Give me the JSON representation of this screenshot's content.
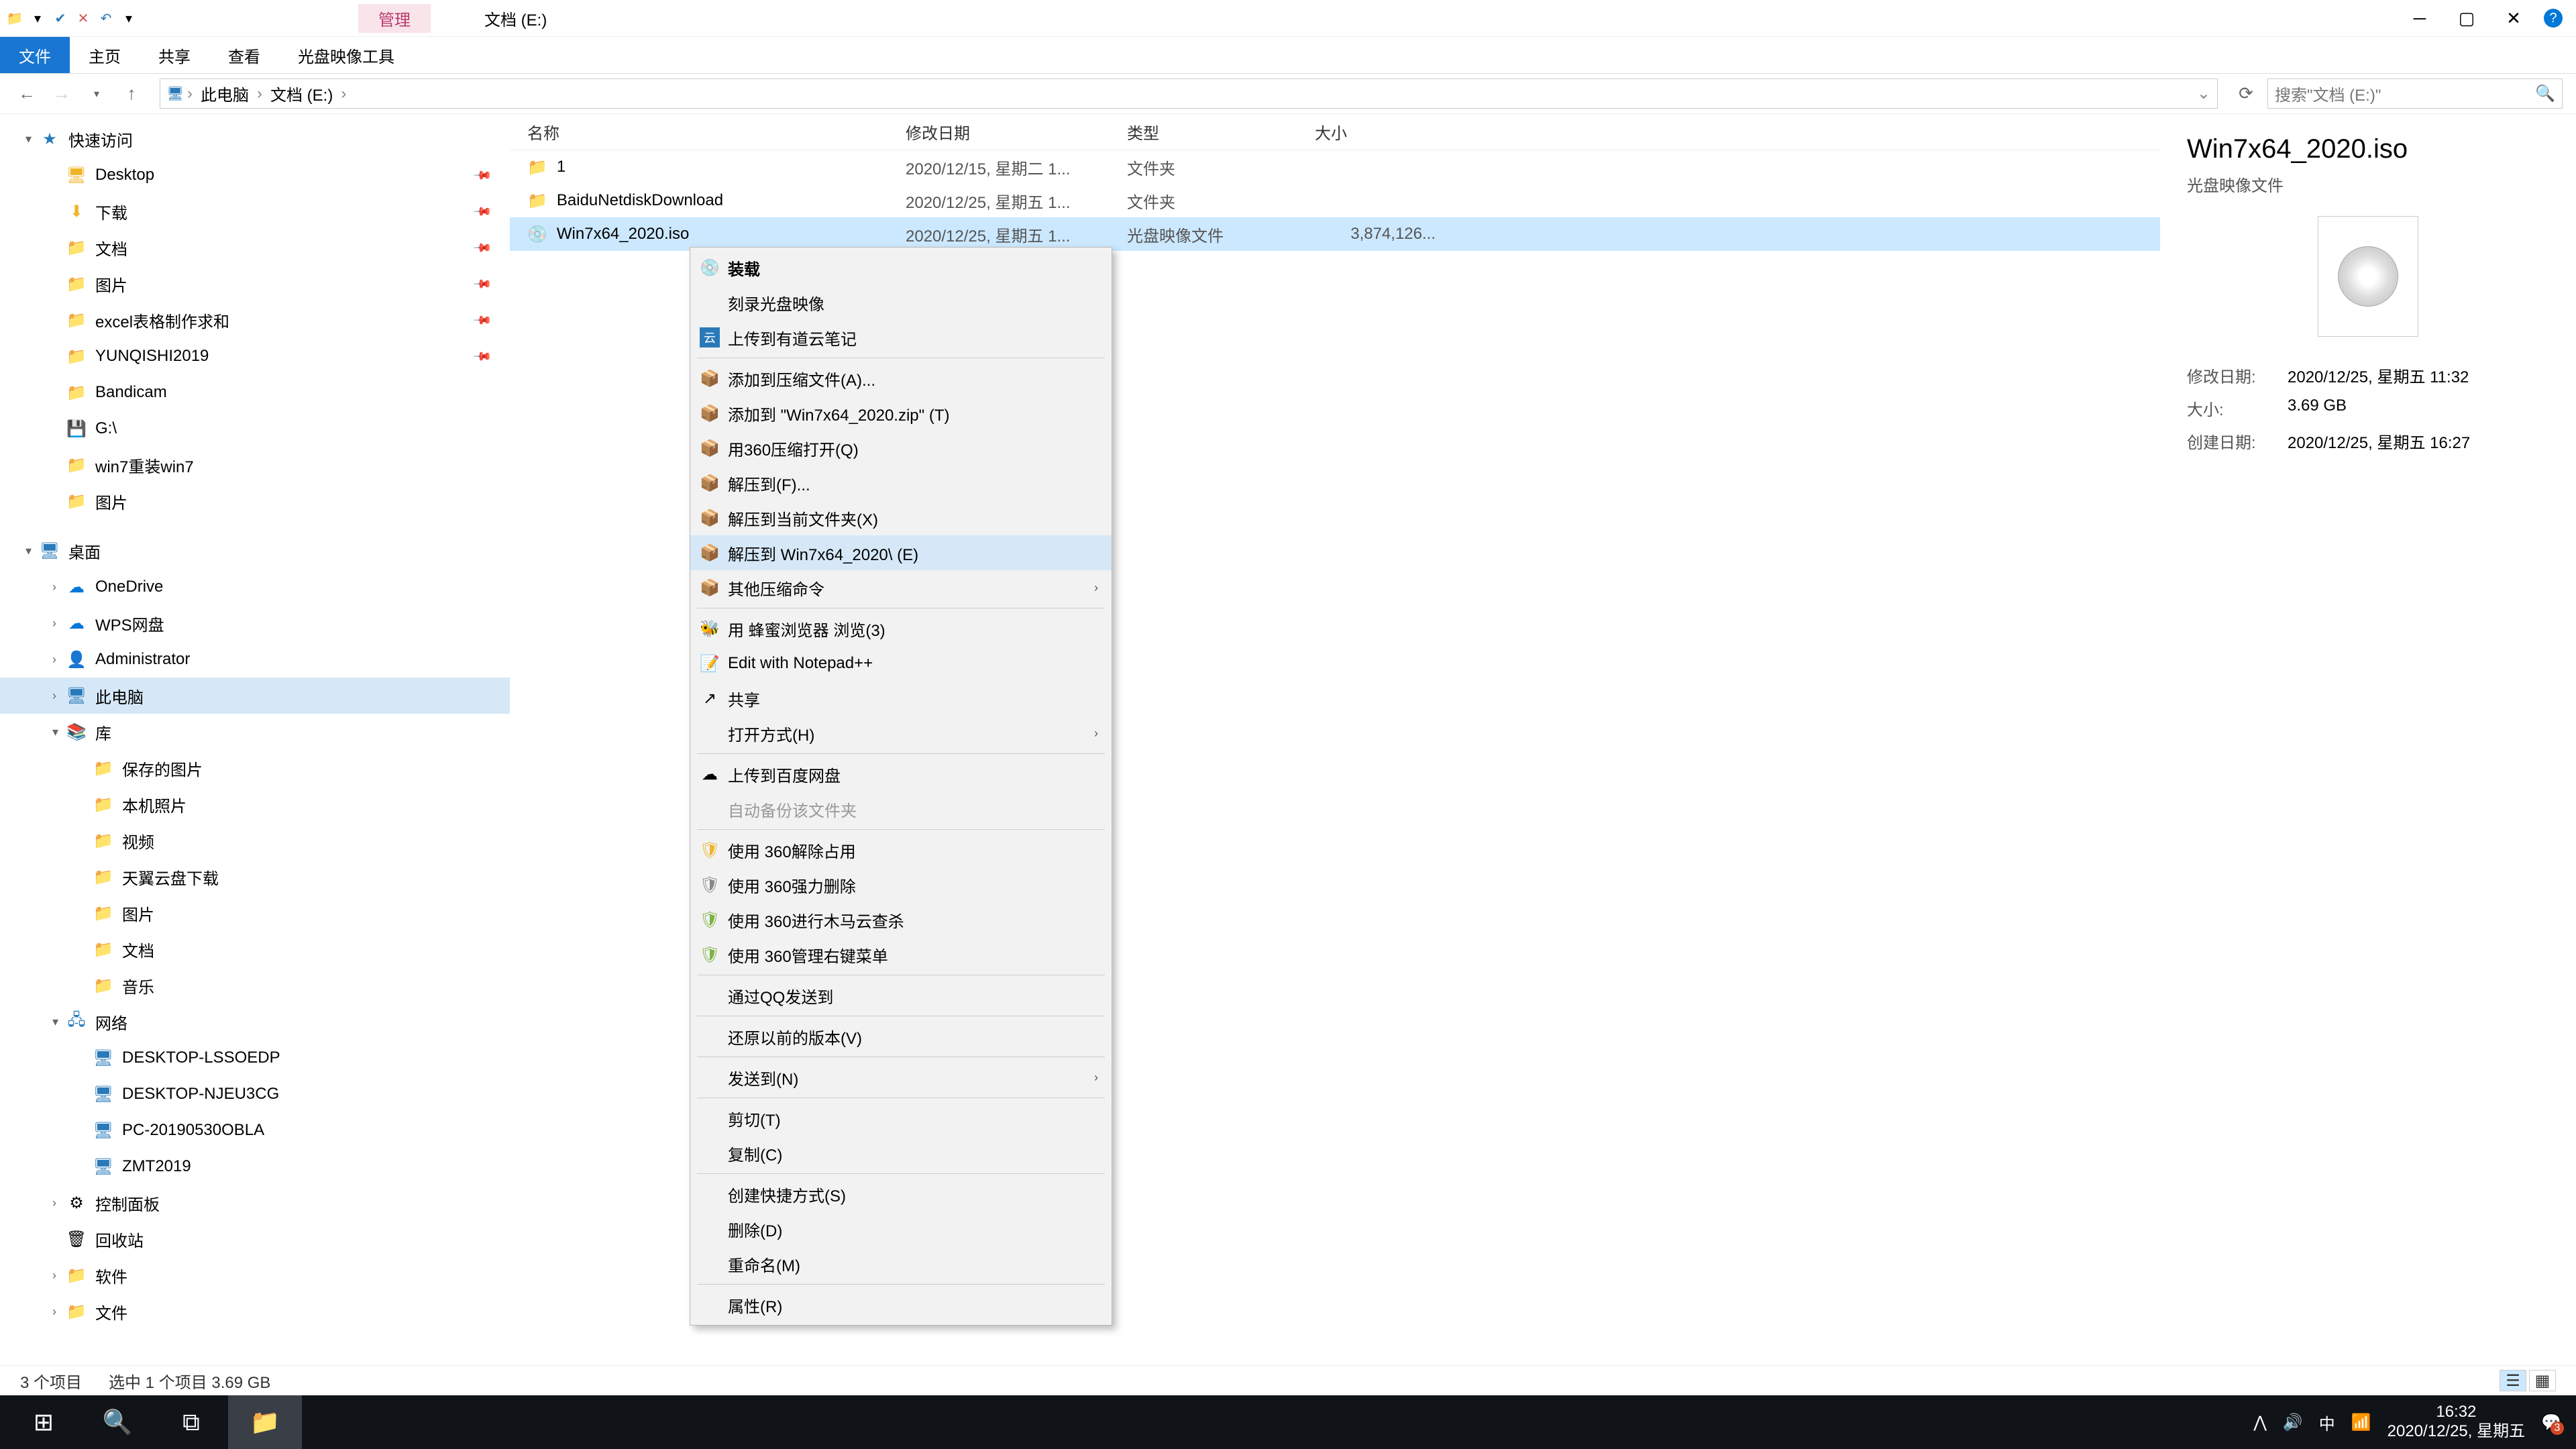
{
  "window": {
    "tab_highlight": "管理",
    "title": "文档 (E:)",
    "ribbon": {
      "file": "文件",
      "home": "主页",
      "share": "共享",
      "view": "查看",
      "disc_tool": "光盘映像工具"
    }
  },
  "address": {
    "pc": "此电脑",
    "drive": "文档 (E:)",
    "search_placeholder": "搜索\"文档 (E:)\""
  },
  "tree": {
    "quick": "快速访问",
    "desktop": "Desktop",
    "downloads": "下载",
    "documents": "文档",
    "pictures": "图片",
    "excel": "excel表格制作求和",
    "yunqishi": "YUNQISHI2019",
    "bandicam": "Bandicam",
    "gdrive": "G:\\",
    "win7reinstall": "win7重装win7",
    "pics2": "图片",
    "desktop_root": "桌面",
    "onedrive": "OneDrive",
    "wps": "WPS网盘",
    "admin": "Administrator",
    "thispc": "此电脑",
    "libraries": "库",
    "saved_pics": "保存的图片",
    "local_photos": "本机照片",
    "videos": "视频",
    "tianyi": "天翼云盘下载",
    "pics3": "图片",
    "docs2": "文档",
    "music": "音乐",
    "network": "网络",
    "pc1": "DESKTOP-LSSOEDP",
    "pc2": "DESKTOP-NJEU3CG",
    "pc3": "PC-20190530OBLA",
    "pc4": "ZMT2019",
    "control": "控制面板",
    "recycle": "回收站",
    "software": "软件",
    "files": "文件"
  },
  "columns": {
    "name": "名称",
    "date": "修改日期",
    "type": "类型",
    "size": "大小"
  },
  "rows": [
    {
      "name": "1",
      "date": "2020/12/15, 星期二 1...",
      "type": "文件夹",
      "size": "",
      "icon": "folder"
    },
    {
      "name": "BaiduNetdiskDownload",
      "date": "2020/12/25, 星期五 1...",
      "type": "文件夹",
      "size": "",
      "icon": "folder"
    },
    {
      "name": "Win7x64_2020.iso",
      "date": "2020/12/25, 星期五 1...",
      "type": "光盘映像文件",
      "size": "3,874,126...",
      "icon": "disc",
      "selected": true
    }
  ],
  "context": {
    "mount": "装载",
    "burn": "刻录光盘映像",
    "youdao": "上传到有道云笔记",
    "addarc": "添加到压缩文件(A)...",
    "addzip": "添加到 \"Win7x64_2020.zip\" (T)",
    "open360": "用360压缩打开(Q)",
    "extractto": "解压到(F)...",
    "extracthere": "解压到当前文件夹(X)",
    "extractfolder": "解压到 Win7x64_2020\\ (E)",
    "othercomp": "其他压缩命令",
    "honey": "用 蜂蜜浏览器 浏览(3)",
    "notepad": "Edit with Notepad++",
    "share": "共享",
    "openwith": "打开方式(H)",
    "baidu": "上传到百度网盘",
    "autobackup": "自动备份该文件夹",
    "unlock360": "使用 360解除占用",
    "forcedel": "使用 360强力删除",
    "trojan": "使用 360进行木马云查杀",
    "rightmenu": "使用 360管理右键菜单",
    "qqsend": "通过QQ发送到",
    "restore": "还原以前的版本(V)",
    "sendto": "发送到(N)",
    "cut": "剪切(T)",
    "copy": "复制(C)",
    "shortcut": "创建快捷方式(S)",
    "delete": "删除(D)",
    "rename": "重命名(M)",
    "props": "属性(R)"
  },
  "details": {
    "title": "Win7x64_2020.iso",
    "subtitle": "光盘映像文件",
    "mod_label": "修改日期:",
    "mod_val": "2020/12/25, 星期五 11:32",
    "size_label": "大小:",
    "size_val": "3.69 GB",
    "create_label": "创建日期:",
    "create_val": "2020/12/25, 星期五 16:27"
  },
  "status": {
    "items": "3 个项目",
    "selected": "选中 1 个项目  3.69 GB"
  },
  "taskbar": {
    "time": "16:32",
    "date": "2020/12/25, 星期五",
    "ime": "中"
  }
}
